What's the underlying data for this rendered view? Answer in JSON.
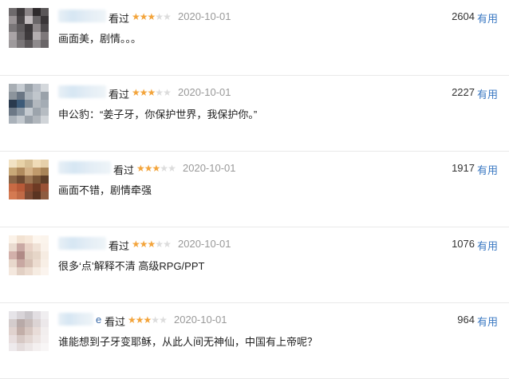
{
  "reviews": [
    {
      "name_tail": "",
      "watched": "看过",
      "rating": 3,
      "date": "2020-10-01",
      "votes": "2604",
      "useful": "有用",
      "comment": "画面美，剧情。。。",
      "avatar": [
        "#6e6a6c",
        "#3e3a3c",
        "#8a8486",
        "#2e2a2c",
        "#5a5658",
        "#9a9496",
        "#4a4648",
        "#c2bcbe",
        "#6a6668",
        "#3a3638",
        "#7a7678",
        "#5e5a5c",
        "#3a3638",
        "#8e888a",
        "#4e4a4c",
        "#aaa4a6",
        "#6a6668",
        "#3e3a3c",
        "#b4aeb0",
        "#7e787a",
        "#9e9a9c",
        "#7a7678",
        "#5a5658",
        "#8e8a8c",
        "#6a6668"
      ]
    },
    {
      "name_tail": "",
      "watched": "看过",
      "rating": 3,
      "date": "2020-10-01",
      "votes": "2227",
      "useful": "有用",
      "comment": "申公豹：“姜子牙，你保护世界，我保护你。”",
      "avatar": [
        "#a8aeb4",
        "#c6ccd2",
        "#9aa2aa",
        "#b8bec6",
        "#d4d8dc",
        "#8c949c",
        "#6a7684",
        "#aab2ba",
        "#c0c6cc",
        "#9aa2aa",
        "#2a3a4e",
        "#3c5a78",
        "#7c8894",
        "#b2b8be",
        "#a4acb4",
        "#6c7886",
        "#8a96a2",
        "#c4cad0",
        "#9ca4ac",
        "#b6bcc2",
        "#aab2ba",
        "#c2c8ce",
        "#9aa2aa",
        "#b0b6bc",
        "#d0d4d8"
      ]
    },
    {
      "name_tail": "",
      "watched": "看过",
      "rating": 3,
      "date": "2020-10-01",
      "votes": "1917",
      "useful": "有用",
      "comment": "画面不错，剧情牵强",
      "avatar": [
        "#f2e2c4",
        "#e8d2a8",
        "#d8c096",
        "#f0dcb8",
        "#e6d0aa",
        "#c8a878",
        "#b08a5e",
        "#d4b288",
        "#c09a6c",
        "#a88458",
        "#8a6446",
        "#6e4a32",
        "#9c7654",
        "#7a5638",
        "#5e3e28",
        "#c86a44",
        "#b85a38",
        "#8a4a30",
        "#6e3a24",
        "#9a5236",
        "#d47a52",
        "#c06a46",
        "#7a4a34",
        "#5a3422",
        "#8e5c40"
      ]
    },
    {
      "name_tail": "",
      "watched": "看过",
      "rating": 3,
      "date": "2020-10-01",
      "votes": "1076",
      "useful": "有用",
      "comment": "很多‘点’解释不清 高级RPG/PPT",
      "avatar": [
        "#fbf2e8",
        "#f2e2d2",
        "#f6e8da",
        "#fdf6ee",
        "#fbf4ec",
        "#eadbd0",
        "#c9a9a4",
        "#e8d2c6",
        "#f0e2d6",
        "#faf2ea",
        "#d2b0aa",
        "#b08a86",
        "#deccbe",
        "#e6d6c8",
        "#f6ece2",
        "#e8d8cc",
        "#c8a8a2",
        "#d6c0b4",
        "#ecdcd0",
        "#f8efe6",
        "#f4e8de",
        "#e2d0c4",
        "#ecdcd0",
        "#f6ece2",
        "#fbf4ee"
      ]
    },
    {
      "name_tail": "e",
      "watched": "看过",
      "rating": 3,
      "date": "2020-10-01",
      "votes": "964",
      "useful": "有用",
      "comment": "谁能想到子牙变耶稣，从此人间无神仙，中国有上帝呢？",
      "avatar": [
        "#e6e4e8",
        "#d8d4d8",
        "#cac6ca",
        "#e2dee2",
        "#f0eef0",
        "#d4cccc",
        "#b8aaa8",
        "#c8bcba",
        "#dcd4d4",
        "#ece8ea",
        "#e0d2ce",
        "#c2aea8",
        "#d6c6c0",
        "#e8dcd8",
        "#f2eeee",
        "#e8dede",
        "#d6c8c4",
        "#e2d6d2",
        "#ecE4e2",
        "#f4f0f0",
        "#eeeaec",
        "#e4dcdc",
        "#ece6e6",
        "#f4f0f0",
        "#f8f6f6"
      ]
    }
  ],
  "colors": {
    "star_on": "#f3a43b",
    "star_off": "#dcdcdc",
    "useful": "#3a78c2",
    "date": "#999999"
  }
}
